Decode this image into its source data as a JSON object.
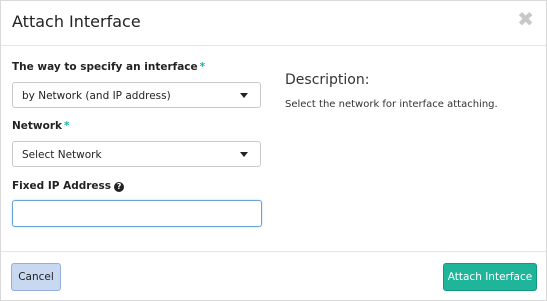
{
  "dialog": {
    "title": "Attach Interface",
    "close_symbol": "✖"
  },
  "form": {
    "way": {
      "label": "The way to specify an interface",
      "required_mark": "*",
      "selected": "by Network (and IP address)"
    },
    "network": {
      "label": "Network",
      "required_mark": "*",
      "selected": "Select Network"
    },
    "fixed_ip": {
      "label": "Fixed IP Address",
      "help_symbol": "?",
      "value": ""
    }
  },
  "description": {
    "title": "Description:",
    "text": "Select the network for interface attaching."
  },
  "footer": {
    "cancel_label": "Cancel",
    "submit_label": "Attach Interface"
  },
  "colors": {
    "accent": "#1eb59b",
    "required": "#1bb3a6",
    "cancel_bg": "#c8d8f0"
  }
}
